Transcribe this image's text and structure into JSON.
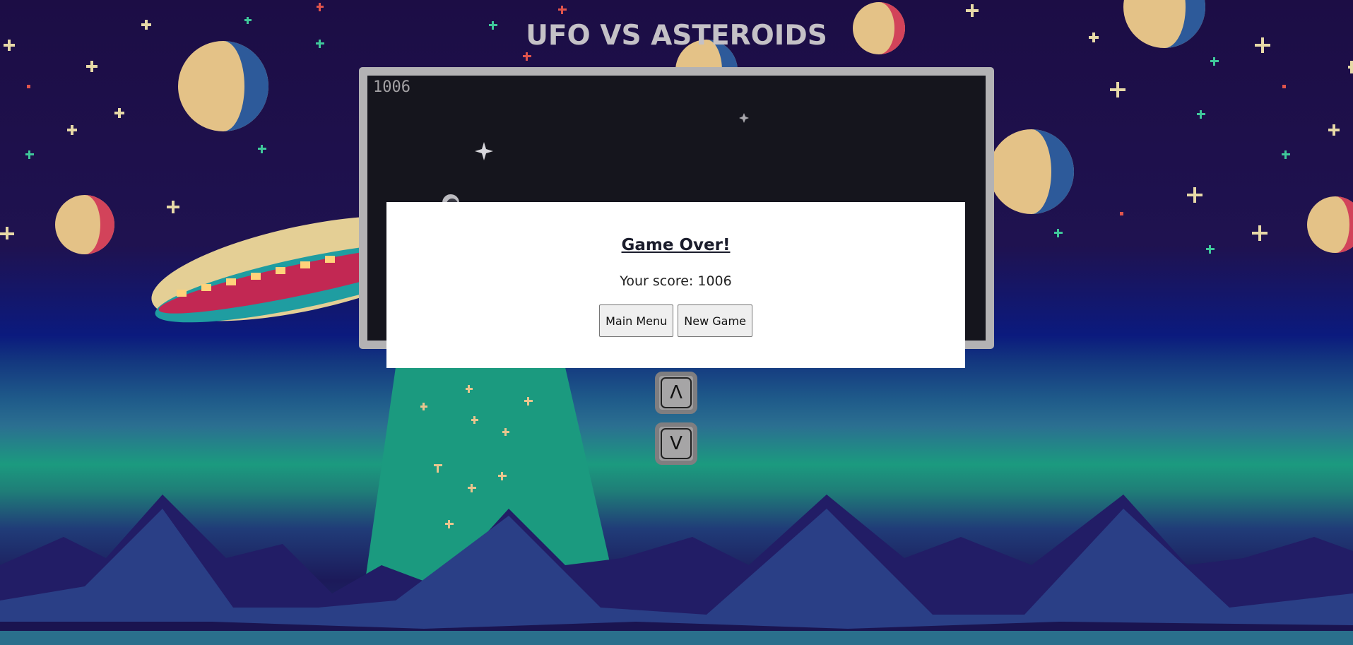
{
  "page": {
    "title": "UFO VS ASTEROIDS"
  },
  "game": {
    "score_display": "1006"
  },
  "modal": {
    "title": "Game Over!",
    "score_text": "Your score: 1006",
    "main_menu_label": "Main Menu",
    "new_game_label": "New Game"
  },
  "controls": {
    "up_label": "Λ",
    "down_label": "V"
  },
  "colors": {
    "title_text": "#c4c1c6",
    "frame": "#b3b2b4",
    "canvas": "#15151d",
    "sky": "#1f1250",
    "beam": "#1b9a7f"
  }
}
